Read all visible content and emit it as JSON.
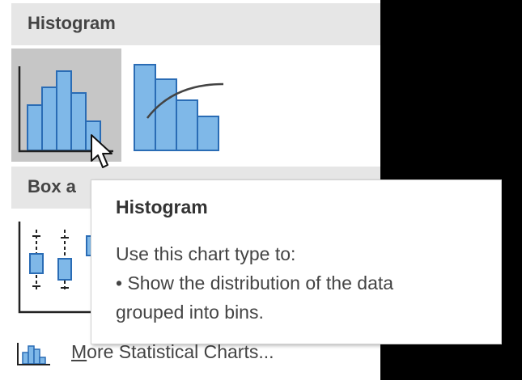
{
  "menu": {
    "histogram_section": {
      "title": "Histogram",
      "items": [
        {
          "name": "Histogram",
          "icon": "histogram-chart-icon",
          "hovered": true
        },
        {
          "name": "Pareto",
          "icon": "pareto-chart-icon",
          "hovered": false
        }
      ]
    },
    "box_section": {
      "title": "Box a",
      "items": [
        {
          "name": "Box and Whisker",
          "icon": "box-whisker-chart-icon"
        }
      ]
    },
    "more_link": {
      "mnemonic": "M",
      "rest": "ore Statistical Charts...",
      "icon": "statistical-chart-icon"
    }
  },
  "tooltip": {
    "title": "Histogram",
    "line1": "Use this chart type to:",
    "line2": "• Show the distribution of the data",
    "line3": "grouped into bins."
  },
  "colors": {
    "bar_fill": "#7fb8e8",
    "bar_stroke": "#2a6cb5",
    "hover_bg": "#c6c6c6",
    "header_bg": "#e6e6e6"
  }
}
